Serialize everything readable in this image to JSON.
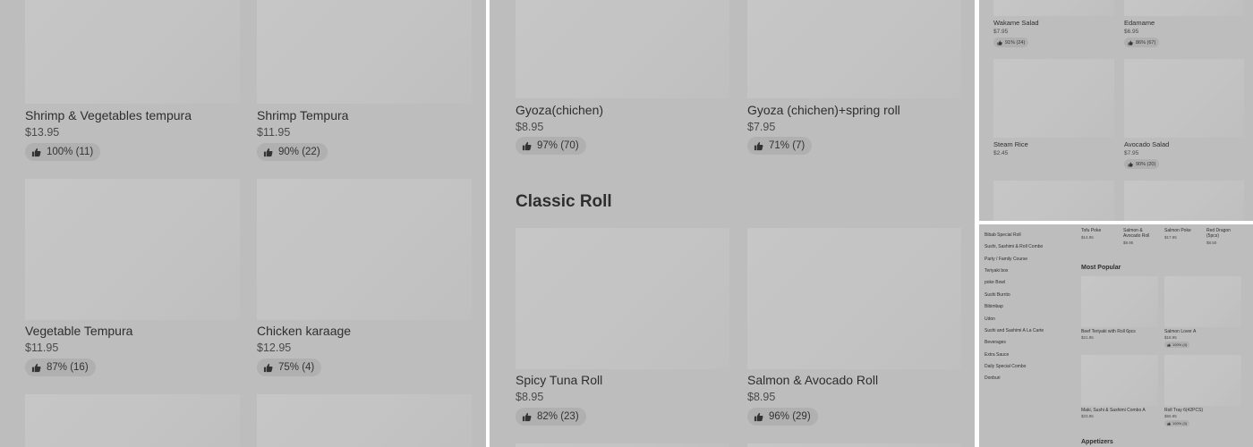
{
  "panel1": {
    "items": [
      {
        "name": "Shrimp & Vegetables tempura",
        "price": "$13.95",
        "rating": "100% (11)"
      },
      {
        "name": "Shrimp Tempura",
        "price": "$11.95",
        "rating": "90% (22)"
      },
      {
        "name": "Vegetable Tempura",
        "price": "$11.95",
        "rating": "87% (16)"
      },
      {
        "name": "Chicken karaage",
        "price": "$12.95",
        "rating": "75% (4)"
      }
    ]
  },
  "panel2": {
    "items": [
      {
        "name": "Gyoza(chichen)",
        "price": "$8.95",
        "rating": "97% (70)"
      },
      {
        "name": "Gyoza (chichen)+spring roll",
        "price": "$7.95",
        "rating": "71% (7)"
      },
      {
        "name": "Spicy Tuna Roll",
        "price": "$8.95",
        "rating": "82% (23)"
      },
      {
        "name": "Salmon & Avocado Roll",
        "price": "$8.95",
        "rating": "96% (29)"
      }
    ],
    "section_title": "Classic Roll"
  },
  "panel3": {
    "items": [
      {
        "name": "Wakame Salad",
        "price": "$7.95",
        "rating": "91% (24)"
      },
      {
        "name": "Edamame",
        "price": "$6.95",
        "rating": "86% (67)"
      },
      {
        "name": "Steam Rice",
        "price": "$2.45",
        "rating": ""
      },
      {
        "name": "Avocado Salad",
        "price": "$7.95",
        "rating": "90% (20)"
      }
    ]
  },
  "panel4": {
    "sidebar": [
      "Bibab Special Roll",
      "Sushi, Sashimi & Roll Combo",
      "Party / Family Course",
      "Teriyaki box",
      "poke Bowl",
      "Sushi Burrito",
      "Bibimbap",
      "Udon",
      "Sushi and Sashimi A La Carte",
      "Beverages",
      "Extra Sauce",
      "Daily Special Combo",
      "Donburi"
    ],
    "top_row": [
      {
        "name": "Tofu  Poke",
        "price": "$14.95"
      },
      {
        "name": "Salmon & Avocado Roll",
        "price": "$8.95"
      },
      {
        "name": "Salmon Poke",
        "price": "$17.95"
      },
      {
        "name": "Red Dragon (5pcs)",
        "price": "$8.50"
      }
    ],
    "most_popular_title": "Most Popular",
    "popular": [
      {
        "name": "Beef Teriyaki with Roll 6pcs",
        "price": "$21.95",
        "rating": ""
      },
      {
        "name": "Salmon Lover A",
        "price": "$18.95",
        "rating": "100% (4)"
      },
      {
        "name": "Maki, Sushi & Sashimi Combo A",
        "price": "$23.95",
        "rating": ""
      },
      {
        "name": "Roll Tray 6(42PCS)",
        "price": "$55.95",
        "rating": "100% (3)"
      }
    ],
    "appetizers_title": "Appetizers"
  },
  "icons": {
    "rating": "thumbs-up-icon"
  },
  "colors": {
    "panel_bg": "#bdbdbd",
    "image_placeholder": "#c4c4c4",
    "rating_pill": "#b0b0b0",
    "text": "#2e2e2e"
  }
}
